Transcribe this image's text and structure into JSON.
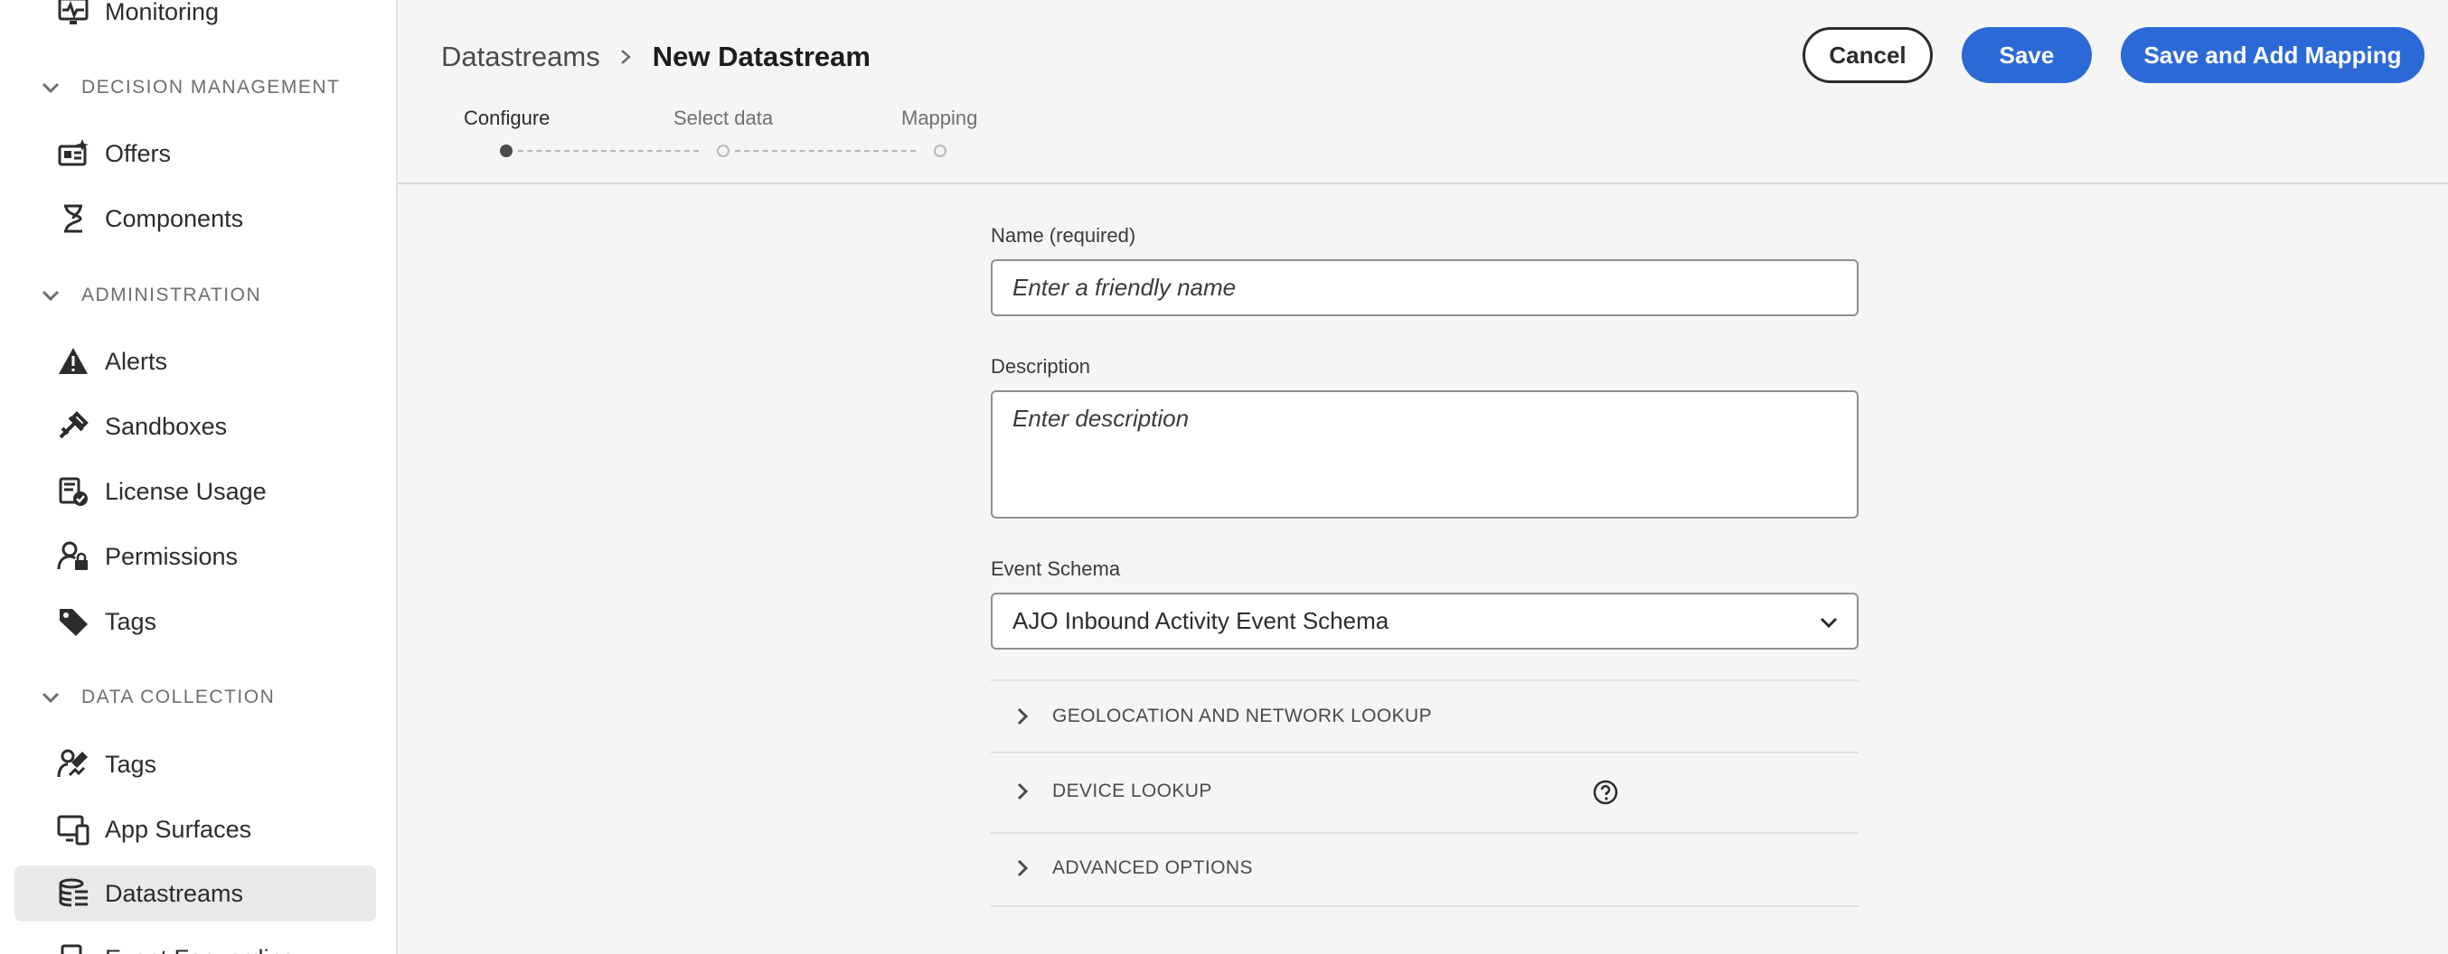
{
  "sidebar": {
    "top_item": {
      "label": "Monitoring",
      "icon": "monitoring-icon"
    },
    "sections": [
      {
        "header": "DECISION MANAGEMENT",
        "items": [
          {
            "label": "Offers",
            "icon": "offers-icon"
          },
          {
            "label": "Components",
            "icon": "components-icon"
          }
        ]
      },
      {
        "header": "ADMINISTRATION",
        "items": [
          {
            "label": "Alerts",
            "icon": "alert-icon"
          },
          {
            "label": "Sandboxes",
            "icon": "sandboxes-icon"
          },
          {
            "label": "License Usage",
            "icon": "license-usage-icon"
          },
          {
            "label": "Permissions",
            "icon": "permissions-icon"
          },
          {
            "label": "Tags",
            "icon": "tag-icon"
          }
        ]
      },
      {
        "header": "DATA COLLECTION",
        "items": [
          {
            "label": "Tags",
            "icon": "tags-hand-icon"
          },
          {
            "label": "App Surfaces",
            "icon": "app-surfaces-icon"
          },
          {
            "label": "Datastreams",
            "icon": "datastreams-icon",
            "selected": true
          },
          {
            "label": "Event Forwarding",
            "icon": "event-forwarding-icon"
          }
        ]
      }
    ]
  },
  "header": {
    "breadcrumb": [
      "Datastreams",
      "New Datastream"
    ],
    "buttons": {
      "cancel": "Cancel",
      "save": "Save",
      "save_and_map": "Save and Add Mapping"
    }
  },
  "steps": [
    {
      "label": "Configure",
      "active": true
    },
    {
      "label": "Select data",
      "active": false
    },
    {
      "label": "Mapping",
      "active": false
    }
  ],
  "form": {
    "name": {
      "label": "Name (required)",
      "placeholder": "Enter a friendly name",
      "value": ""
    },
    "description": {
      "label": "Description",
      "placeholder": "Enter description",
      "value": ""
    },
    "event_schema": {
      "label": "Event Schema",
      "selected": "AJO Inbound Activity Event Schema"
    },
    "accordions": [
      {
        "title": "GEOLOCATION AND NETWORK LOOKUP",
        "help": false
      },
      {
        "title": "DEVICE LOOKUP",
        "help": true
      },
      {
        "title": "ADVANCED OPTIONS",
        "help": false
      }
    ]
  },
  "colors": {
    "accent": "#2b6ad6",
    "sidebar_selected": "#e9e9e9",
    "background": "#f5f5f5"
  }
}
